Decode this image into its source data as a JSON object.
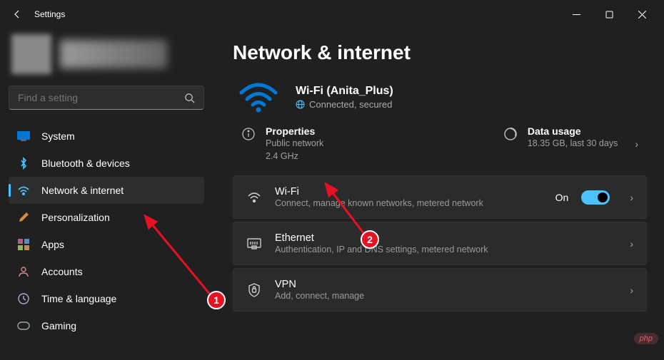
{
  "window": {
    "title": "Settings"
  },
  "search": {
    "placeholder": "Find a setting"
  },
  "sidebar": {
    "items": [
      {
        "icon": "system",
        "label": "System"
      },
      {
        "icon": "bluetooth",
        "label": "Bluetooth & devices"
      },
      {
        "icon": "network",
        "label": "Network & internet"
      },
      {
        "icon": "personalization",
        "label": "Personalization"
      },
      {
        "icon": "apps",
        "label": "Apps"
      },
      {
        "icon": "accounts",
        "label": "Accounts"
      },
      {
        "icon": "time",
        "label": "Time & language"
      },
      {
        "icon": "gaming",
        "label": "Gaming"
      }
    ]
  },
  "page": {
    "title": "Network & internet"
  },
  "wifi_status": {
    "title": "Wi-Fi (Anita_Plus)",
    "subtitle": "Connected, secured"
  },
  "properties": {
    "title": "Properties",
    "line1": "Public network",
    "line2": "2.4 GHz"
  },
  "data_usage": {
    "title": "Data usage",
    "sub": "18.35 GB, last 30 days"
  },
  "cards": {
    "wifi": {
      "title": "Wi-Fi",
      "sub": "Connect, manage known networks, metered network",
      "toggle_label": "On"
    },
    "ethernet": {
      "title": "Ethernet",
      "sub": "Authentication, IP and DNS settings, metered network"
    },
    "vpn": {
      "title": "VPN",
      "sub": "Add, connect, manage"
    }
  },
  "annotations": {
    "badge1": "1",
    "badge2": "2"
  },
  "watermark": "php"
}
